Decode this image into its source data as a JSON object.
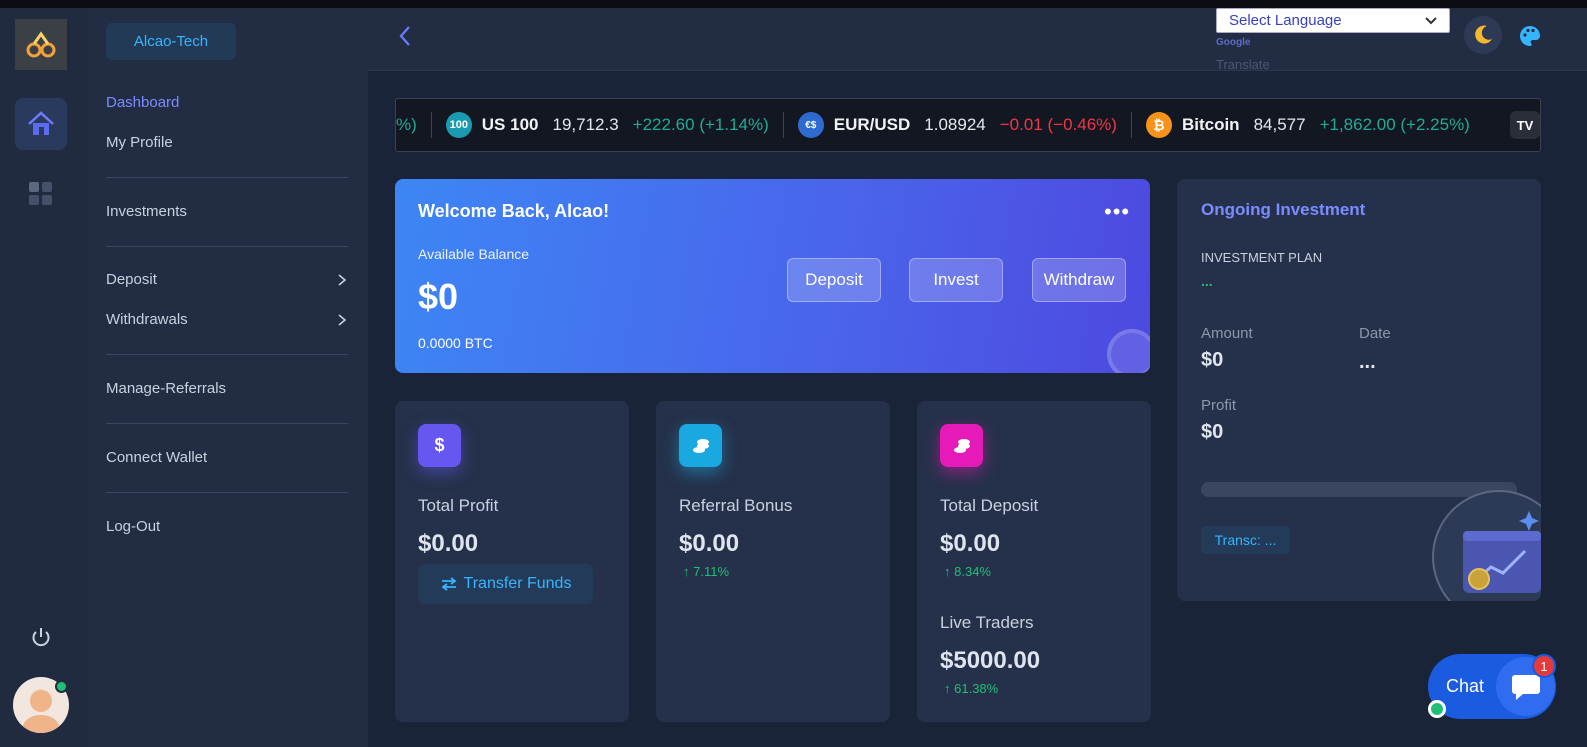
{
  "sidebar": {
    "brand": "Alcao-Tech",
    "items": [
      {
        "label": "Dashboard"
      },
      {
        "label": "My Profile"
      },
      {
        "label": "Investments"
      },
      {
        "label": "Deposit"
      },
      {
        "label": "Withdrawals"
      },
      {
        "label": "Manage-Referrals"
      },
      {
        "label": "Connect Wallet"
      },
      {
        "label": "Log-Out"
      }
    ]
  },
  "header": {
    "language_select": "Select Language",
    "google_label": "Google",
    "translate_label": "Translate"
  },
  "ticker": {
    "leading_fragment": "%)",
    "items": [
      {
        "icon_text": "100",
        "name": "US 100",
        "price": "19,712.3",
        "change": "+222.60 (+1.14%)",
        "direction": "up"
      },
      {
        "icon_text": "€$",
        "name": "EUR/USD",
        "price": "1.08924",
        "change": "−0.01 (−0.46%)",
        "direction": "down"
      },
      {
        "icon_text": "₿",
        "name": "Bitcoin",
        "price": "84,577",
        "change": "+1,862.00 (+2.25%)",
        "direction": "up"
      }
    ],
    "brand_badge": "TV"
  },
  "welcome": {
    "title": "Welcome Back, Alcao!",
    "menu": "•••",
    "balance_label": "Available Balance",
    "balance": "$0",
    "btc": "0.0000 BTC",
    "buttons": {
      "deposit": "Deposit",
      "invest": "Invest",
      "withdraw": "Withdraw"
    }
  },
  "stats": [
    {
      "label": "Total Profit",
      "value": "$0.00",
      "action": "Transfer Funds",
      "icon": "dollar-icon"
    },
    {
      "label": "Referral Bonus",
      "value": "$0.00",
      "pct": "7.11%",
      "icon": "coins-icon"
    },
    {
      "label": "Total Deposit",
      "value": "$0.00",
      "pct": "8.34%",
      "icon": "coins-icon",
      "extra_label": "Live Traders",
      "extra_value": "$5000.00",
      "extra_pct": "61.38%"
    }
  ],
  "investment": {
    "title": "Ongoing Investment",
    "plan_label": "INVESTMENT PLAN",
    "plan_value": "...",
    "amount_label": "Amount",
    "amount_value": "$0",
    "date_label": "Date",
    "date_value": "...",
    "profit_label": "Profit",
    "profit_value": "$0",
    "progress": 0,
    "badge": "Transc: ..."
  },
  "chat": {
    "label": "Chat",
    "unread": "1"
  },
  "colors": {
    "accent": "#7a8cff",
    "link": "#36b5ff",
    "positive": "#1fbf76",
    "negative": "#f23645"
  }
}
